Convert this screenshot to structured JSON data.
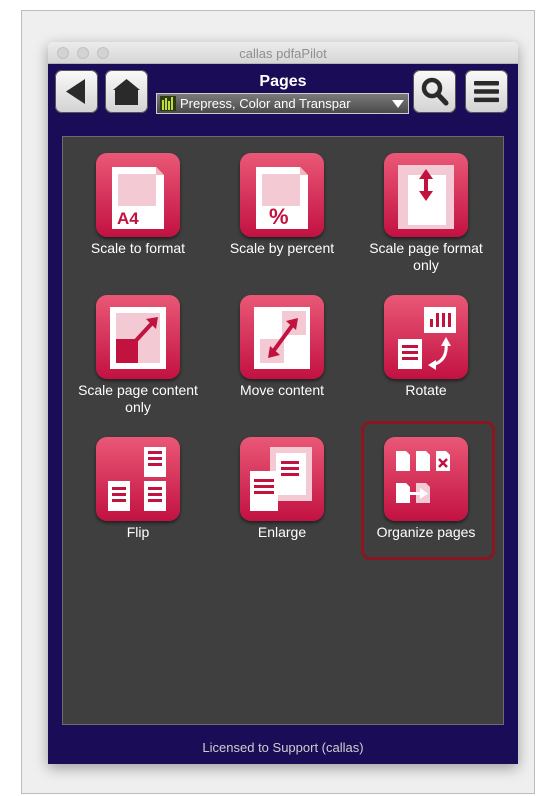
{
  "window": {
    "title": "callas pdfaPilot"
  },
  "header": {
    "title": "Pages",
    "profile_selected": "Prepress, Color and Transparency",
    "profile_display": "Prepress, Color and Transpar"
  },
  "tiles": [
    {
      "label": "Scale to format",
      "icon": "a4-page-icon",
      "extra": "A4"
    },
    {
      "label": "Scale by percent",
      "icon": "percent-page-icon",
      "extra": "%"
    },
    {
      "label": "Scale page format only",
      "icon": "page-format-arrows-icon"
    },
    {
      "label": "Scale page content only",
      "icon": "content-diagonal-arrow-icon"
    },
    {
      "label": "Move content",
      "icon": "move-content-icon"
    },
    {
      "label": "Rotate",
      "icon": "rotate-pages-icon"
    },
    {
      "label": "Flip",
      "icon": "flip-pages-icon"
    },
    {
      "label": "Enlarge",
      "icon": "enlarge-pages-icon"
    },
    {
      "label": "Organize pages",
      "icon": "organize-pages-icon",
      "selected": true
    }
  ],
  "footer": {
    "license": "Licensed to Support (callas)"
  },
  "colors": {
    "app_background": "#1a0c56",
    "tile_accent": "#d62554",
    "content_background": "#3f3f3f",
    "selection_border": "#8c1522"
  }
}
